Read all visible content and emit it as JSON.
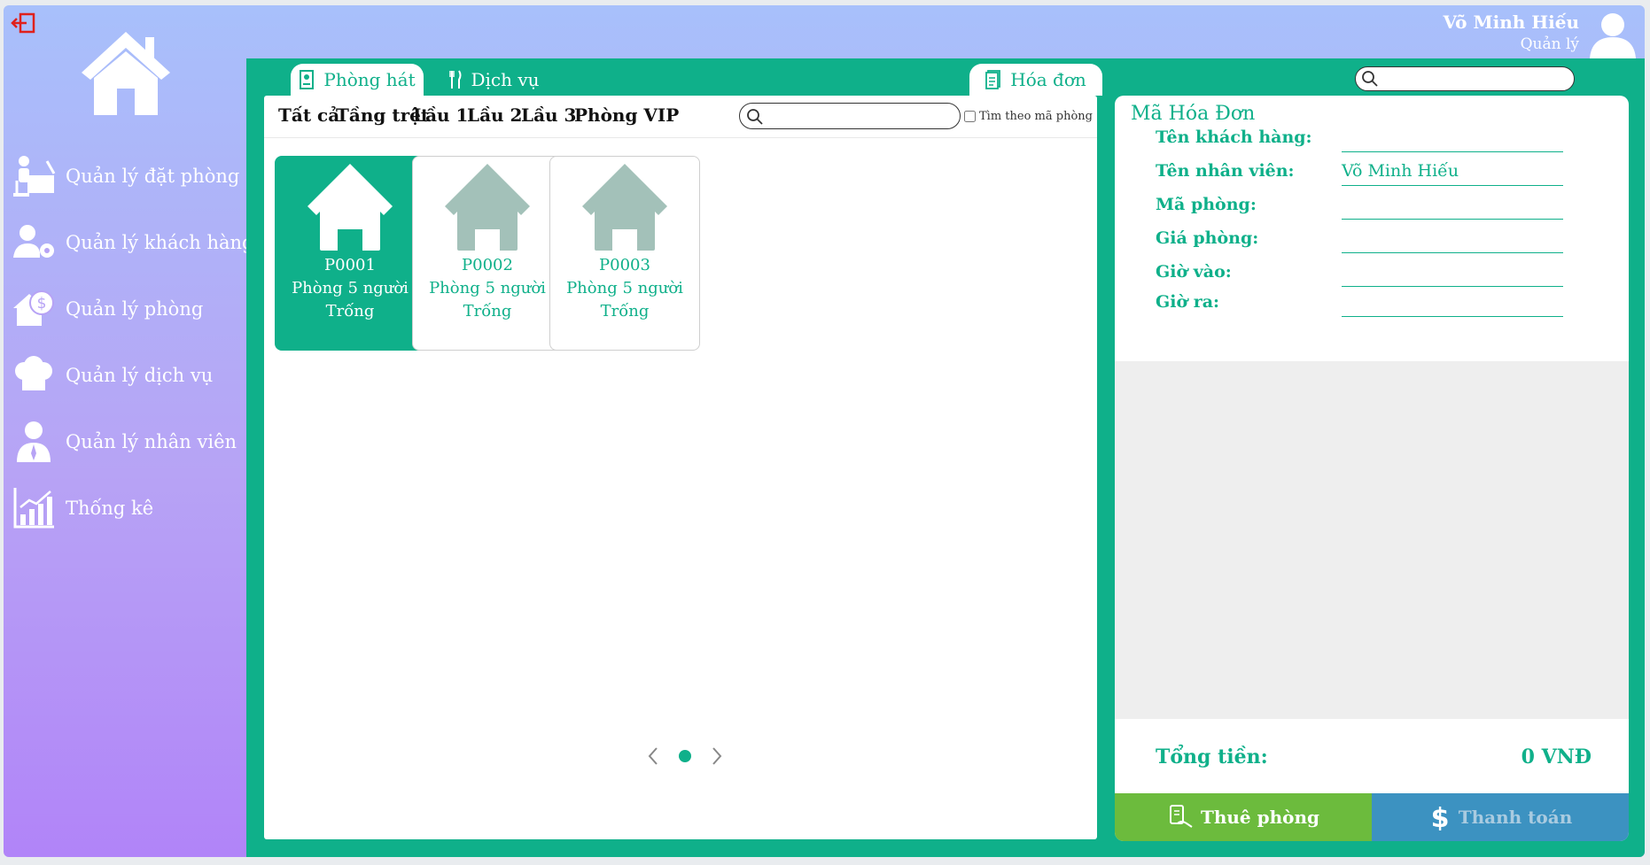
{
  "user": {
    "name": "Võ Minh Hiếu",
    "role": "Quản lý"
  },
  "nav": [
    {
      "label": "Quản lý đặt phòng",
      "icon": "reception-desk-icon"
    },
    {
      "label": "Quản lý khách hàng",
      "icon": "customer-settings-icon"
    },
    {
      "label": "Quản lý phòng",
      "icon": "house-money-icon"
    },
    {
      "label": "Quản lý dịch vụ",
      "icon": "chef-hat-icon"
    },
    {
      "label": "Quản lý nhân viên",
      "icon": "employee-icon"
    },
    {
      "label": "Thống kê",
      "icon": "statistics-chart-icon"
    }
  ],
  "tabs": {
    "rooms": "Phòng hát",
    "services": "Dịch vụ",
    "invoice": "Hóa đơn"
  },
  "filters": [
    "Tất cả",
    "Tầng trệt",
    "Lầu 1",
    "Lầu 2",
    "Lầu 3",
    "Phòng VIP"
  ],
  "room_search": {
    "value": "",
    "checkbox_label": "Tìm theo mã phòng",
    "checked": false
  },
  "rooms": [
    {
      "code": "P0001",
      "type": "Phòng 5 người",
      "status": "Trống",
      "selected": true
    },
    {
      "code": "P0002",
      "type": "Phòng 5 người",
      "status": "Trống",
      "selected": false
    },
    {
      "code": "P0003",
      "type": "Phòng 5 người",
      "status": "Trống",
      "selected": false
    }
  ],
  "pager": {
    "pages": 1,
    "current": 1
  },
  "invoice_search": {
    "value": ""
  },
  "invoice": {
    "title": "Mã Hóa Đơn",
    "customer_label": "Tên khách hàng:",
    "customer": "",
    "employee_label": "Tên nhân viên:",
    "employee": "Võ Minh Hiếu",
    "room_label": "Mã phòng:",
    "room": "",
    "price_label": "Giá phòng:",
    "price": "",
    "checkin_label": "Giờ vào:",
    "checkin": "",
    "checkout_label": "Giờ ra:",
    "checkout": "",
    "total_label": "Tổng tiền:",
    "total": "0 VNĐ"
  },
  "actions": {
    "rent": "Thuê phòng",
    "pay": "Thanh toán"
  },
  "colors": {
    "accent": "#0fb08a",
    "rent": "#6cbb3d",
    "pay": "#3c92c1",
    "house_inactive": "#a3c1b9"
  }
}
